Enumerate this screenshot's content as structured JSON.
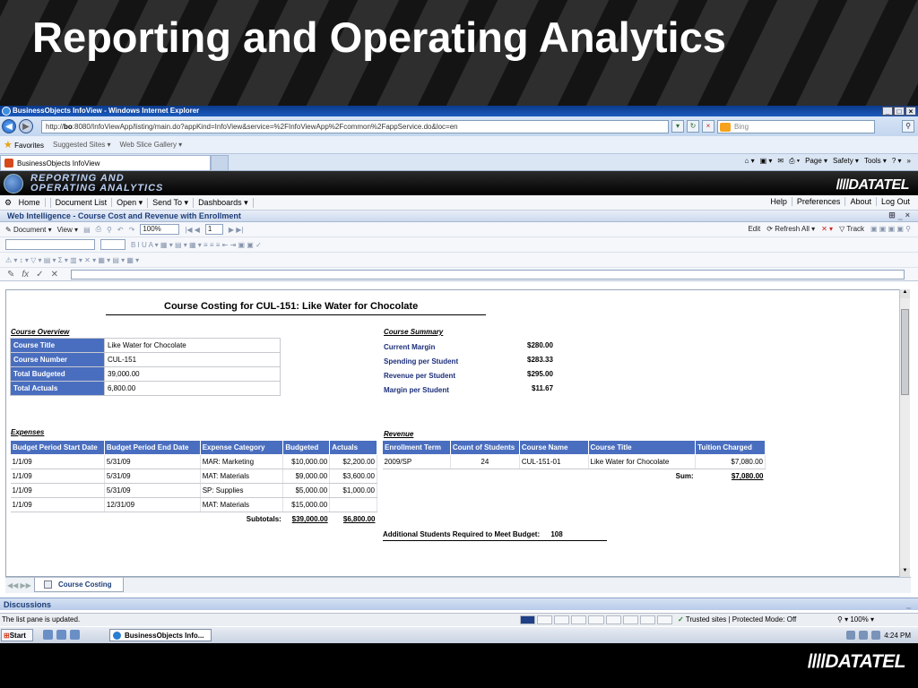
{
  "slide": {
    "title": "Reporting and Operating Analytics",
    "footer_logo": "DATATEL"
  },
  "browser": {
    "window_title": "BusinessObjects InfoView - Windows Internet Explorer",
    "url_prefix": "http://",
    "url_host": "bo",
    "url_rest": ":8080/InfoViewApp/listing/main.do?appKind=InfoView&service=%2FInfoViewApp%2Fcommon%2FappService.do&loc=en",
    "search_placeholder": "Bing",
    "favorites_label": "Favorites",
    "suggested_sites": "Suggested Sites ▾",
    "web_slice_gallery": "Web Slice Gallery ▾",
    "tab_title": "BusinessObjects InfoView",
    "cmd_page": "Page ▾",
    "cmd_safety": "Safety ▾",
    "cmd_tools": "Tools ▾"
  },
  "bo": {
    "header_line1": "Reporting and",
    "header_line2": "Operating Analytics",
    "brand": "DATATEL",
    "menu": [
      "Home",
      "Document List",
      "Open ▾",
      "Send To ▾",
      "Dashboards ▾"
    ],
    "menu_right": [
      "Help",
      "Preferences",
      "About",
      "Log Out"
    ],
    "webi_title": "Web Intelligence - Course Cost and Revenue with Enrollment",
    "toolbar1": {
      "document": "Document ▾",
      "view": "View ▾",
      "zoom": "100%",
      "page": "1",
      "edit": "Edit",
      "refresh_all": "Refresh All ▾",
      "track": "Track"
    },
    "sheet_tab": "Course Costing",
    "discussions": "Discussions"
  },
  "report": {
    "title": "Course Costing for CUL-151: Like Water for Chocolate",
    "overview_header": "Course Overview",
    "overview": [
      {
        "label": "Course Title",
        "value": "Like Water for Chocolate"
      },
      {
        "label": "Course Number",
        "value": "CUL-151"
      },
      {
        "label": "Total Budgeted",
        "value": "39,000.00"
      },
      {
        "label": "Total Actuals",
        "value": "6,800.00"
      }
    ],
    "summary_header": "Course Summary",
    "summary": [
      {
        "label": "Current Margin",
        "value": "$280.00"
      },
      {
        "label": "Spending per Student",
        "value": "$283.33"
      },
      {
        "label": "Revenue per Student",
        "value": "$295.00"
      },
      {
        "label": "Margin per Student",
        "value": "$11.67"
      }
    ],
    "expenses_header": "Expenses",
    "expenses_columns": [
      "Budget Period Start Date",
      "Budget Period End Date",
      "Expense Category",
      "Budgeted",
      "Actuals"
    ],
    "expenses_rows": [
      [
        "1/1/09",
        "5/31/09",
        "MAR: Marketing",
        "$10,000.00",
        "$2,200.00"
      ],
      [
        "1/1/09",
        "5/31/09",
        "MAT: Materials",
        "$9,000.00",
        "$3,600.00"
      ],
      [
        "1/1/09",
        "5/31/09",
        "SP: Supplies",
        "$5,000.00",
        "$1,000.00"
      ],
      [
        "1/1/09",
        "12/31/09",
        "MAT: Materials",
        "$15,000.00",
        ""
      ]
    ],
    "subtotals_label": "Subtotals:",
    "subtotal_budgeted": "$39,000.00",
    "subtotal_actuals": "$6,800.00",
    "revenue_header": "Revenue",
    "revenue_columns": [
      "Enrollment Term",
      "Count of Students",
      "Course Name",
      "Course Title",
      "Tuition Charged"
    ],
    "revenue_rows": [
      [
        "2009/SP",
        "24",
        "CUL-151-01",
        "Like Water for Chocolate",
        "$7,080.00"
      ]
    ],
    "sum_label": "Sum:",
    "sum_value": "$7,080.00",
    "additional_label": "Additional Students Required to Meet Budget:",
    "additional_value": "108"
  },
  "status": {
    "text": "The list pane is updated.",
    "zone": "Trusted sites | Protected Mode: Off",
    "zoom": "100%",
    "start": "Start",
    "task": "BusinessObjects Info...",
    "clock": "4:24 PM"
  }
}
